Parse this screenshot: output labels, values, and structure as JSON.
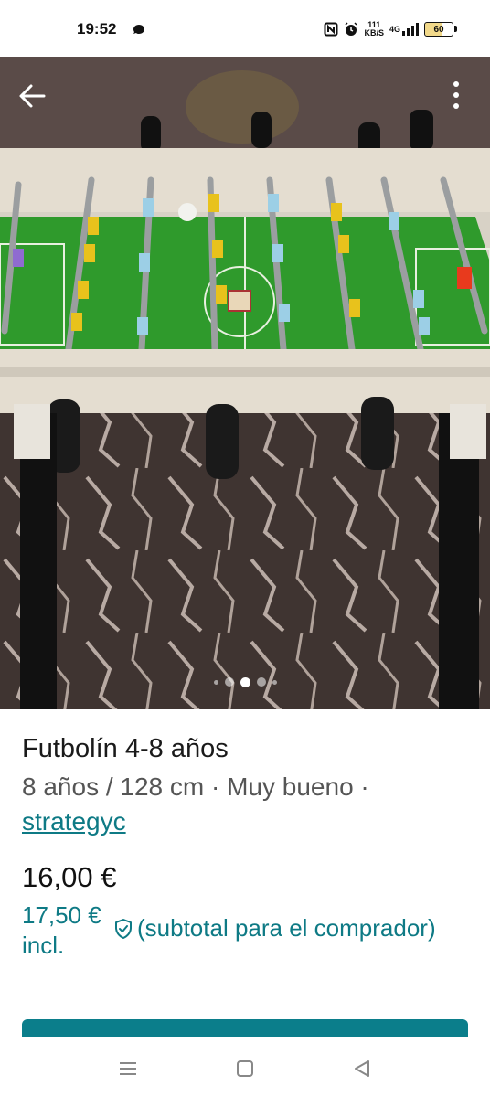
{
  "status_bar": {
    "time": "19:52",
    "speed_value": "111",
    "speed_unit": "KB/S",
    "network": "4G",
    "battery": "60"
  },
  "photo": {
    "carousel_total": 5,
    "carousel_active": 2
  },
  "listing": {
    "title": "Futbolín 4-8 años",
    "details": "8 años / 128 cm · Muy bueno ·",
    "seller": "strategyc",
    "price": "16,00 €",
    "price_incl": "17,50 € incl.",
    "buyer_note": "(subtotal para el comprador)"
  },
  "colors": {
    "accent": "#0e7a85",
    "button": "#0b7e8b",
    "field_green": "#2f9a2c"
  },
  "icons": {
    "back": "arrow-left-icon",
    "more": "more-vertical-icon",
    "shield": "shield-check-icon",
    "nav_menu": "menu-icon",
    "nav_home": "home-square-icon",
    "nav_back": "back-triangle-icon"
  }
}
